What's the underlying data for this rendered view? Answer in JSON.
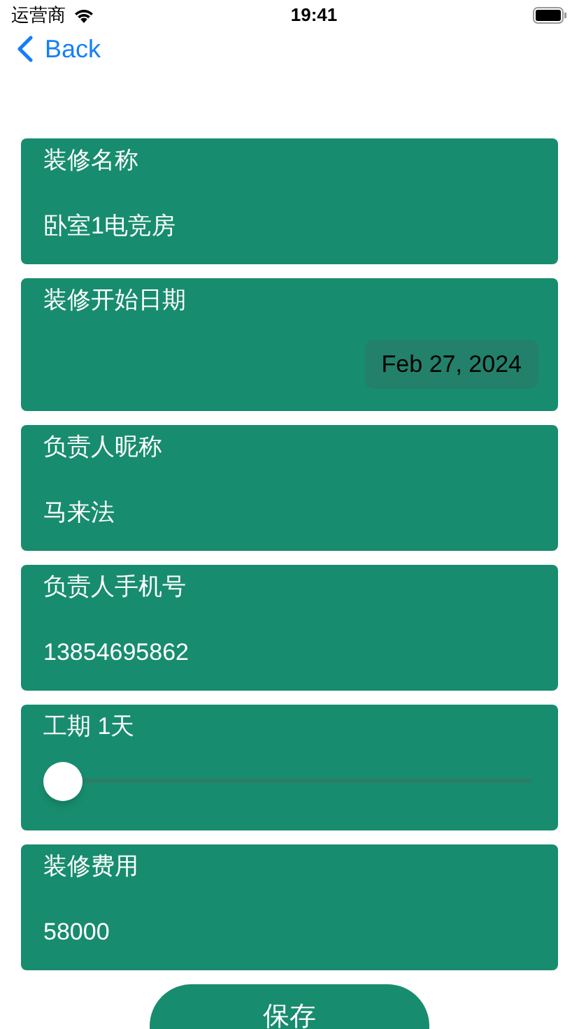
{
  "status_bar": {
    "carrier": "运营商",
    "time": "19:41"
  },
  "nav": {
    "back": "Back"
  },
  "fields": [
    {
      "kind": "text",
      "label": "装修名称",
      "value": "卧室1电竞房"
    },
    {
      "kind": "date",
      "label": "装修开始日期",
      "value": "Feb 27, 2024"
    },
    {
      "kind": "text",
      "label": "负责人昵称",
      "value": "马来法"
    },
    {
      "kind": "text",
      "label": "负责人手机号",
      "value": "13854695862"
    },
    {
      "kind": "slider",
      "label": "工期 1天",
      "level": 0
    },
    {
      "kind": "text",
      "label": "装修费用",
      "value": "58000"
    }
  ],
  "save_button": "保存"
}
